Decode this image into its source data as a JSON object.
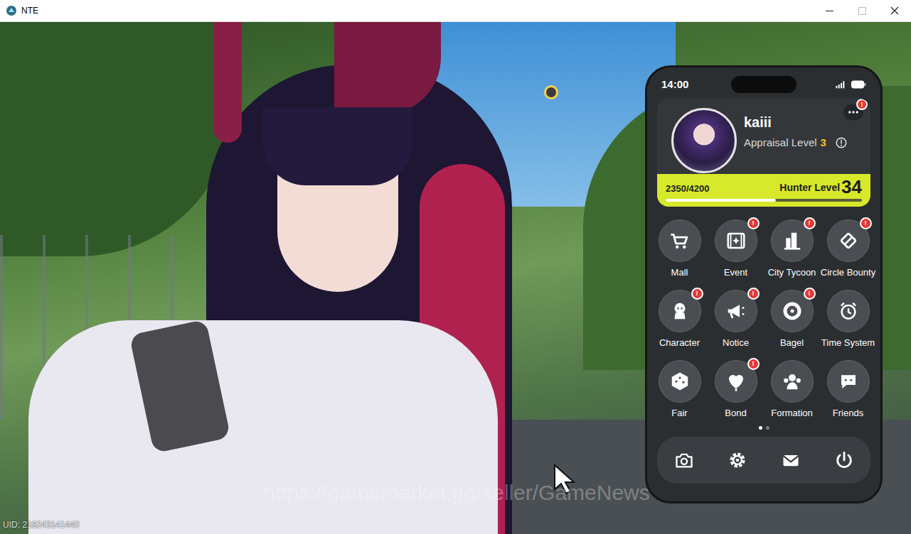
{
  "window": {
    "title": "NTE"
  },
  "scene": {
    "uid": "UID: 218243141440",
    "watermark": "https://gamemarket.gg/seller/GameNews"
  },
  "phone": {
    "time": "14:00",
    "profile": {
      "name": "kaiii",
      "appraisal_label": "Appraisal Level",
      "appraisal_level": "3",
      "exp": "2350/4200",
      "hunter_label": "Hunter Level",
      "hunter_level": "34",
      "level": 0.56,
      "menu_badge": true
    },
    "badge_glyph": "!",
    "apps": [
      {
        "label": "Mall",
        "badge": false
      },
      {
        "label": "Event",
        "badge": true
      },
      {
        "label": "City Tycoon",
        "badge": true
      },
      {
        "label": "Circle Bounty",
        "badge": true
      },
      {
        "label": "Character",
        "badge": true
      },
      {
        "label": "Notice",
        "badge": true
      },
      {
        "label": "Bagel",
        "badge": true
      },
      {
        "label": "Time System",
        "badge": false
      },
      {
        "label": "Fair",
        "badge": false
      },
      {
        "label": "Bond",
        "badge": true
      },
      {
        "label": "Formation",
        "badge": false
      },
      {
        "label": "Friends",
        "badge": false
      }
    ],
    "pages": [
      {
        "selected": true
      },
      {
        "selected": false
      }
    ]
  }
}
